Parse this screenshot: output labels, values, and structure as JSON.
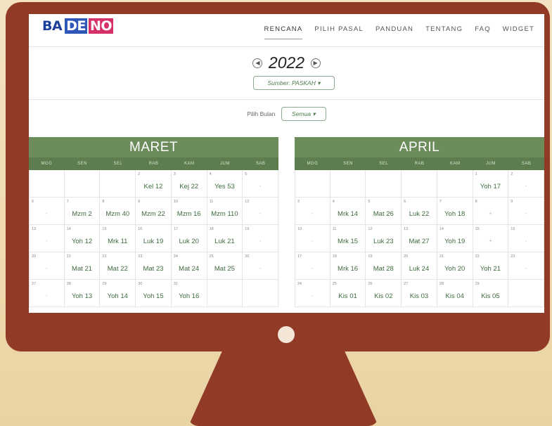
{
  "brand": {
    "p1": "BA",
    "p2": "DE",
    "p3": "NO"
  },
  "nav": [
    "RENCANA",
    "PILIH PASAL",
    "PANDUAN",
    "TENTANG",
    "FAQ",
    "WIDGET"
  ],
  "year": {
    "prev_icon": "◀",
    "value": "2022",
    "next_icon": "▶"
  },
  "source": "Sumber: PASKAH ▾",
  "month_filter": {
    "label": "Pilih Bulan",
    "value": "Semua ▾"
  },
  "weekdays": [
    "MGG",
    "SEN",
    "SEL",
    "RAB",
    "KAM",
    "JUM",
    "SAB"
  ],
  "calendars": [
    {
      "month": "MARET",
      "cells": [
        [
          "",
          ""
        ],
        [
          "",
          ""
        ],
        [
          "",
          ""
        ],
        [
          "2",
          "Kel 12"
        ],
        [
          "3",
          "Kej 22"
        ],
        [
          "4",
          "Yes 53"
        ],
        [
          "5",
          "-"
        ],
        [
          "6",
          "-"
        ],
        [
          "7",
          "Mzm 2"
        ],
        [
          "8",
          "Mzm 40"
        ],
        [
          "9",
          "Mzm 22"
        ],
        [
          "10",
          "Mzm 16"
        ],
        [
          "11",
          "Mzm 110"
        ],
        [
          "12",
          "-"
        ],
        [
          "13",
          "-"
        ],
        [
          "14",
          "Yoh 12"
        ],
        [
          "15",
          "Mrk 11"
        ],
        [
          "16",
          "Luk 19"
        ],
        [
          "17",
          "Luk 20"
        ],
        [
          "18",
          "Luk 21"
        ],
        [
          "19",
          "-"
        ],
        [
          "20",
          "-"
        ],
        [
          "21",
          "Mat 21"
        ],
        [
          "22",
          "Mat 22"
        ],
        [
          "23",
          "Mat 23"
        ],
        [
          "24",
          "Mat 24"
        ],
        [
          "25",
          "Mat 25"
        ],
        [
          "26",
          "-"
        ],
        [
          "27",
          "-"
        ],
        [
          "28",
          "Yoh 13"
        ],
        [
          "29",
          "Yoh 14"
        ],
        [
          "30",
          "Yoh 15"
        ],
        [
          "31",
          "Yoh 16"
        ],
        [
          "",
          ""
        ],
        [
          "",
          ""
        ]
      ]
    },
    {
      "month": "APRIL",
      "cells": [
        [
          "",
          ""
        ],
        [
          "",
          ""
        ],
        [
          "",
          ""
        ],
        [
          "",
          ""
        ],
        [
          "",
          ""
        ],
        [
          "1",
          "Yoh 17"
        ],
        [
          "2",
          "-"
        ],
        [
          "3",
          "-"
        ],
        [
          "4",
          "Mrk 14"
        ],
        [
          "5",
          "Mat 26"
        ],
        [
          "6",
          "Luk 22"
        ],
        [
          "7",
          "Yoh 18"
        ],
        [
          "8",
          "+"
        ],
        [
          "9",
          "-"
        ],
        [
          "10",
          "-"
        ],
        [
          "11",
          "Mrk 15"
        ],
        [
          "12",
          "Luk 23"
        ],
        [
          "13",
          "Mat 27"
        ],
        [
          "14",
          "Yoh 19"
        ],
        [
          "15",
          "+"
        ],
        [
          "16",
          "-"
        ],
        [
          "17",
          "-"
        ],
        [
          "18",
          "Mrk 16"
        ],
        [
          "19",
          "Mat 28"
        ],
        [
          "20",
          "Luk 24"
        ],
        [
          "21",
          "Yoh 20"
        ],
        [
          "22",
          "Yoh 21"
        ],
        [
          "23",
          "-"
        ],
        [
          "24",
          "-"
        ],
        [
          "25",
          "Kis 01"
        ],
        [
          "26",
          "Kis 02"
        ],
        [
          "27",
          "Kis 03"
        ],
        [
          "28",
          "Kis 04"
        ],
        [
          "29",
          "Kis 05"
        ],
        [
          "",
          ""
        ]
      ]
    }
  ]
}
